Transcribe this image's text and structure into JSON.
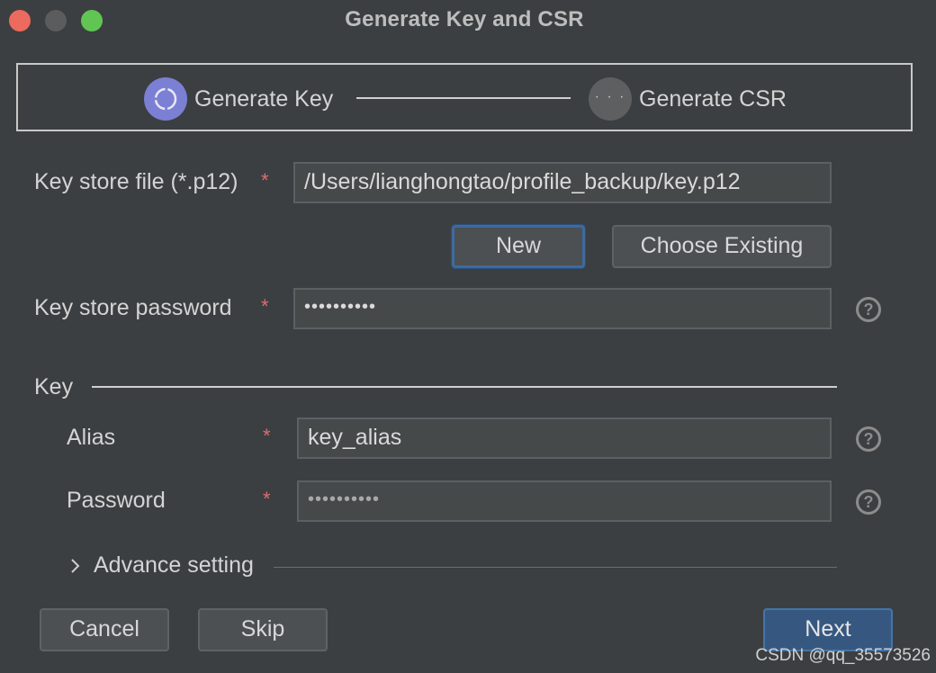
{
  "window": {
    "title": "Generate Key and CSR"
  },
  "stepper": {
    "steps": [
      {
        "label": "Generate Key",
        "icon": "loading-ring-icon",
        "state": "active",
        "color": "#7b80d4"
      },
      {
        "label": "Generate CSR",
        "icon": "ellipsis-icon",
        "state": "pending",
        "color": "#5d5f61"
      }
    ]
  },
  "keystore": {
    "file_label": "Key store file (*.p12)",
    "file_value": "/Users/lianghongtao/profile_backup/key.p12",
    "new_button": "New",
    "choose_existing_button": "Choose Existing",
    "password_label": "Key store password",
    "password_value": "••••••••••",
    "required_mark": "*"
  },
  "key_section": {
    "title": "Key",
    "alias_label": "Alias",
    "alias_value": "key_alias",
    "password_label": "Password",
    "password_value": "••••••••••",
    "help_glyph": "?"
  },
  "advance": {
    "chevron": "›",
    "label": "Advance setting",
    "state": "collapsed"
  },
  "footer": {
    "cancel_button": "Cancel",
    "skip_button": "Skip",
    "next_button": "Next"
  },
  "watermark": "CSDN @qq_35573526",
  "colors": {
    "background": "#3c3f41",
    "accent": "#365880",
    "required": "#e06c6c",
    "focus": "#3d6a9e"
  }
}
